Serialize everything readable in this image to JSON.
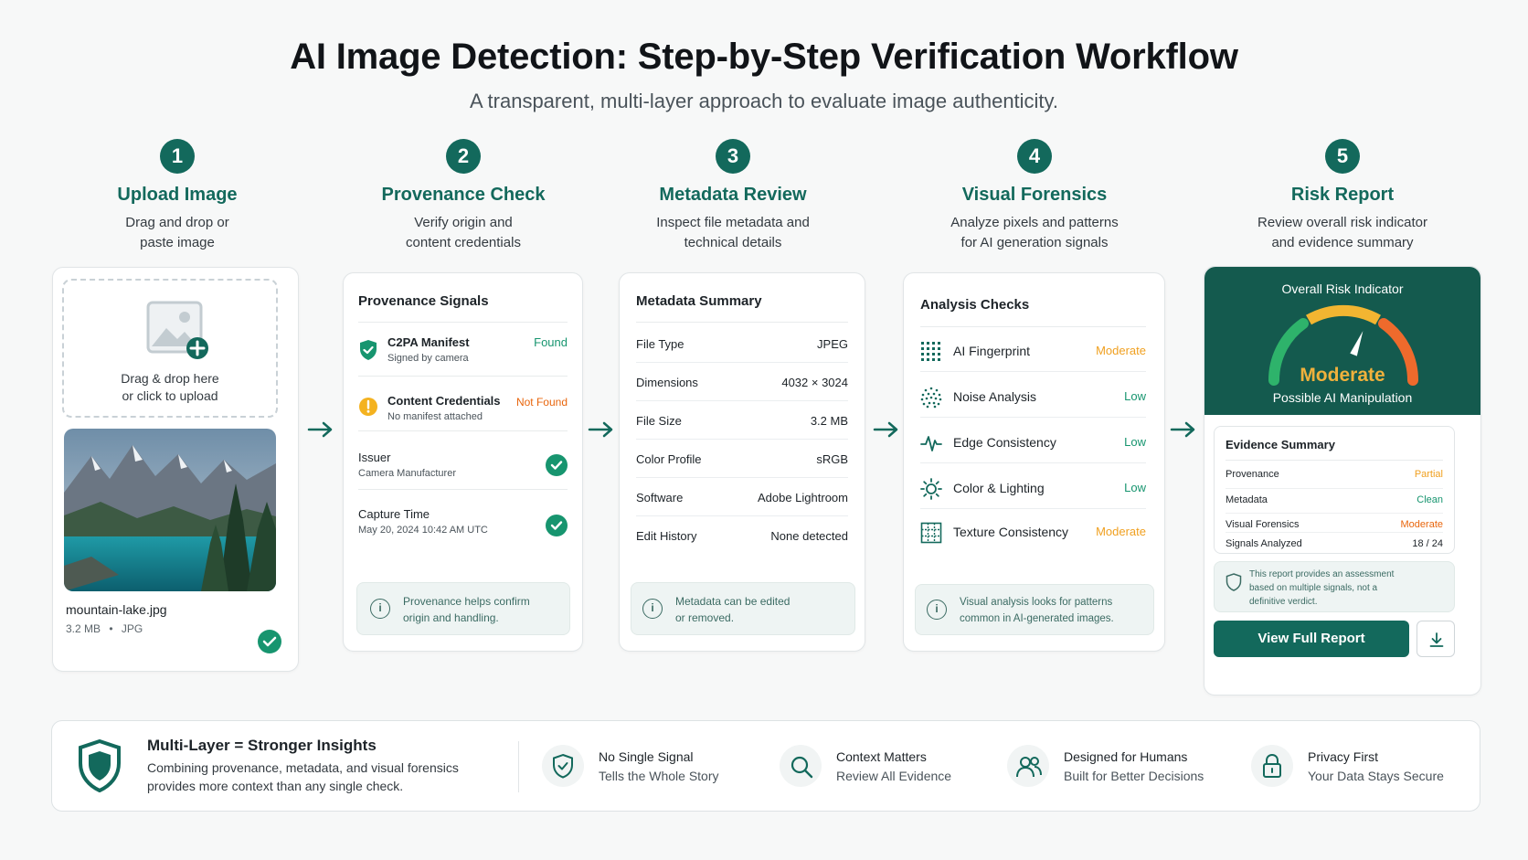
{
  "header": {
    "title": "AI Image Detection: Step-by-Step Verification Workflow",
    "subtitle": "A transparent, multi-layer approach to evaluate image authenticity."
  },
  "steps": [
    {
      "num": "1",
      "name": "Upload Image",
      "desc": "Drag and drop or paste image"
    },
    {
      "num": "2",
      "name": "Provenance Check",
      "desc": "Verify origin and content credentials"
    },
    {
      "num": "3",
      "name": "Metadata Review",
      "desc": "Inspect file metadata and technical details"
    },
    {
      "num": "4",
      "name": "Visual Forensics",
      "desc": "Analyze pixels and patterns for AI generation signals"
    },
    {
      "num": "5",
      "name": "Risk Report",
      "desc": "Review overall risk indicator and evidence summary"
    }
  ],
  "upload": {
    "drop_line1": "Drag & drop here",
    "drop_line2": "or click to upload",
    "file_name": "mountain-lake.jpg",
    "file_size": "3.2 MB",
    "file_sep": "•",
    "file_type": "JPG"
  },
  "provenance": {
    "title": "Provenance Signals",
    "rows": [
      {
        "label": "C2PA Manifest",
        "sub": "Signed by camera",
        "status": "Found"
      },
      {
        "label": "Content Credentials",
        "sub": "No manifest attached",
        "status": "Not Found"
      },
      {
        "label": "Issuer",
        "sub": "Camera Manufacturer"
      },
      {
        "label": "Capture Time",
        "sub": "May 20, 2024 10:42 AM UTC"
      }
    ],
    "info_line1": "Provenance helps confirm",
    "info_line2": "origin and handling."
  },
  "metadata": {
    "title": "Metadata Summary",
    "rows": [
      {
        "key": "File Type",
        "value": "JPEG"
      },
      {
        "key": "Dimensions",
        "value": "4032 × 3024"
      },
      {
        "key": "File Size",
        "value": "3.2 MB"
      },
      {
        "key": "Color Profile",
        "value": "sRGB"
      },
      {
        "key": "Software",
        "value": "Adobe Lightroom"
      },
      {
        "key": "Edit History",
        "value": "None detected"
      }
    ],
    "info_line1": "Metadata can be edited",
    "info_line2": "or removed."
  },
  "analysis": {
    "title": "Analysis Checks",
    "rows": [
      {
        "key": "AI Fingerprint",
        "value": "Moderate"
      },
      {
        "key": "Noise Analysis",
        "value": "Low"
      },
      {
        "key": "Edge Consistency",
        "value": "Low"
      },
      {
        "key": "Color & Lighting",
        "value": "Low"
      },
      {
        "key": "Texture Consistency",
        "value": "Moderate"
      }
    ],
    "info_line1": "Visual analysis looks for patterns",
    "info_line2": "common in AI-generated images."
  },
  "risk": {
    "header": "Overall Risk Indicator",
    "level": "Moderate",
    "level_fraction": 0.62,
    "verdict": "Possible AI Manipulation",
    "evidence_title": "Evidence Summary",
    "evidence": [
      {
        "key": "Provenance",
        "value": "Partial"
      },
      {
        "key": "Metadata",
        "value": "Clean"
      },
      {
        "key": "Visual Forensics",
        "value": "Moderate"
      },
      {
        "key": "Signals Analyzed",
        "value": "18 / 24"
      }
    ],
    "disclaimer_line1": "This report provides an assessment",
    "disclaimer_line2": "based on multiple signals, not a",
    "disclaimer_line3": "definitive verdict.",
    "button_label": "View Full Report"
  },
  "bottom": {
    "main_title": "Multi-Layer = Stronger Insights",
    "main_text_line1": "Combining provenance, metadata, and visual forensics",
    "main_text_line2": "provides more context than any single check.",
    "items": [
      {
        "t1": "No Single Signal",
        "t2": "Tells the Whole Story"
      },
      {
        "t1": "Context Matters",
        "t2": "Review All Evidence"
      },
      {
        "t1": "Designed for Humans",
        "t2": "Built for Better Decisions"
      },
      {
        "t1": "Privacy First",
        "t2": "Your Data Stays Secure"
      }
    ]
  },
  "colors": {
    "brand": "#13695c",
    "found": "#17956f",
    "moderate": "#f0a020",
    "not_found": "#e8650c",
    "low": "#17956f"
  }
}
